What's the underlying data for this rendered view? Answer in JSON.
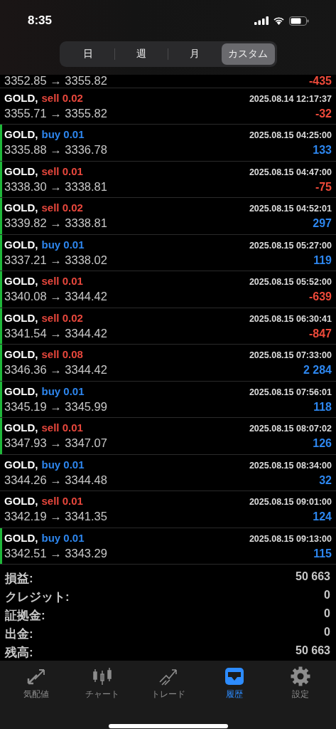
{
  "status_bar": {
    "time": "8:35"
  },
  "periods": [
    {
      "label": "日",
      "selected": false
    },
    {
      "label": "週",
      "selected": false
    },
    {
      "label": "月",
      "selected": false
    },
    {
      "label": "カスタム",
      "selected": true
    }
  ],
  "deals": [
    {
      "kind": "partial",
      "prices": "3352.85 → 3355.82",
      "profit": {
        "text": "-435",
        "color": "#ee4a3a"
      },
      "marked": false
    },
    {
      "kind": "full",
      "symbol": "GOLD,",
      "volume": {
        "text": "sell 0.02",
        "color": "#e8473c"
      },
      "time": "2025.08.14 12:17:37",
      "prices": "3355.71 → 3355.82",
      "profit": {
        "text": "-32",
        "color": "#ee4a3a"
      },
      "marked": false
    },
    {
      "kind": "full",
      "symbol": "GOLD,",
      "volume": {
        "text": "buy 0.01",
        "color": "#2d86ee"
      },
      "time": "2025.08.15 04:25:00",
      "prices": "3335.88 → 3336.78",
      "profit": {
        "text": "133",
        "color": "#2d86ee"
      },
      "marked": true
    },
    {
      "kind": "full",
      "symbol": "GOLD,",
      "volume": {
        "text": "sell 0.01",
        "color": "#e8473c"
      },
      "time": "2025.08.15 04:47:00",
      "prices": "3338.30 → 3338.81",
      "profit": {
        "text": "-75",
        "color": "#ee4a3a"
      },
      "marked": true
    },
    {
      "kind": "full",
      "symbol": "GOLD,",
      "volume": {
        "text": "sell 0.02",
        "color": "#e8473c"
      },
      "time": "2025.08.15 04:52:01",
      "prices": "3339.82 → 3338.81",
      "profit": {
        "text": "297",
        "color": "#2d86ee"
      },
      "marked": true
    },
    {
      "kind": "full",
      "symbol": "GOLD,",
      "volume": {
        "text": "buy 0.01",
        "color": "#2d86ee"
      },
      "time": "2025.08.15 05:27:00",
      "prices": "3337.21 → 3338.02",
      "profit": {
        "text": "119",
        "color": "#2d86ee"
      },
      "marked": true
    },
    {
      "kind": "full",
      "symbol": "GOLD,",
      "volume": {
        "text": "sell 0.01",
        "color": "#e8473c"
      },
      "time": "2025.08.15 05:52:00",
      "prices": "3340.08 → 3344.42",
      "profit": {
        "text": "-639",
        "color": "#ee4a3a"
      },
      "marked": true
    },
    {
      "kind": "full",
      "symbol": "GOLD,",
      "volume": {
        "text": "sell 0.02",
        "color": "#e8473c"
      },
      "time": "2025.08.15 06:30:41",
      "prices": "3341.54 → 3344.42",
      "profit": {
        "text": "-847",
        "color": "#ee4a3a"
      },
      "marked": true
    },
    {
      "kind": "full",
      "symbol": "GOLD,",
      "volume": {
        "text": "sell 0.08",
        "color": "#e8473c"
      },
      "time": "2025.08.15 07:33:00",
      "prices": "3346.36 → 3344.42",
      "profit": {
        "text": "2 284",
        "color": "#2d86ee"
      },
      "marked": true
    },
    {
      "kind": "full",
      "symbol": "GOLD,",
      "volume": {
        "text": "buy 0.01",
        "color": "#2d86ee"
      },
      "time": "2025.08.15 07:56:01",
      "prices": "3345.19 → 3345.99",
      "profit": {
        "text": "118",
        "color": "#2d86ee"
      },
      "marked": true
    },
    {
      "kind": "full",
      "symbol": "GOLD,",
      "volume": {
        "text": "sell 0.01",
        "color": "#e8473c"
      },
      "time": "2025.08.15 08:07:02",
      "prices": "3347.93 → 3347.07",
      "profit": {
        "text": "126",
        "color": "#2d86ee"
      },
      "marked": true
    },
    {
      "kind": "full",
      "symbol": "GOLD,",
      "volume": {
        "text": "buy 0.01",
        "color": "#2d86ee"
      },
      "time": "2025.08.15 08:34:00",
      "prices": "3344.26 → 3344.48",
      "profit": {
        "text": "32",
        "color": "#2d86ee"
      },
      "marked": false
    },
    {
      "kind": "full",
      "symbol": "GOLD,",
      "volume": {
        "text": "sell 0.01",
        "color": "#e8473c"
      },
      "time": "2025.08.15 09:01:00",
      "prices": "3342.19 → 3341.35",
      "profit": {
        "text": "124",
        "color": "#2d86ee"
      },
      "marked": false
    },
    {
      "kind": "full",
      "symbol": "GOLD,",
      "volume": {
        "text": "buy 0.01",
        "color": "#2d86ee"
      },
      "time": "2025.08.15 09:13:00",
      "prices": "3342.51 → 3343.29",
      "profit": {
        "text": "115",
        "color": "#2d86ee"
      },
      "marked": true
    }
  ],
  "summary": [
    {
      "label": "損益:",
      "value": "50 663"
    },
    {
      "label": "クレジット:",
      "value": "0"
    },
    {
      "label": "証拠金:",
      "value": "0"
    },
    {
      "label": "出金:",
      "value": "0"
    },
    {
      "label": "残高:",
      "value": "50 663"
    }
  ],
  "tab_bar": [
    {
      "kind": "quotes",
      "label": "気配値",
      "selected": false
    },
    {
      "kind": "chart",
      "label": "チャート",
      "selected": false
    },
    {
      "kind": "trade",
      "label": "トレード",
      "selected": false
    },
    {
      "kind": "history",
      "label": "履歴",
      "selected": true
    },
    {
      "kind": "settings",
      "label": "設定",
      "selected": false
    }
  ]
}
